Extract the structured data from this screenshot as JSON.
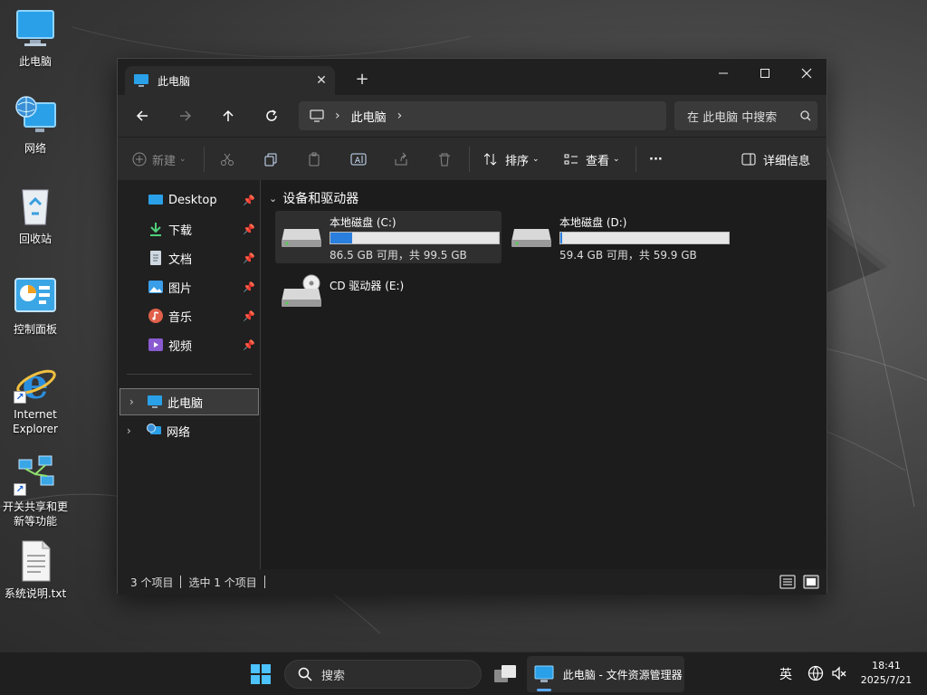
{
  "desktop": {
    "icons": [
      {
        "label": "此电脑",
        "icon": "computer-icon"
      },
      {
        "label": "网络",
        "icon": "network-globe-icon"
      },
      {
        "label": "回收站",
        "icon": "recycle-bin-icon"
      },
      {
        "label": "控制面板",
        "icon": "control-panel-icon"
      },
      {
        "label": "Internet\nExplorer",
        "icon": "internet-explorer-icon"
      },
      {
        "label": "开关共享和更\n新等功能",
        "icon": "share-network-icon"
      },
      {
        "label": "系统说明.txt",
        "icon": "text-file-icon"
      }
    ]
  },
  "window": {
    "tab_title": "此电脑",
    "tab_close": "✕",
    "new_tab": "+",
    "address": {
      "crumbs": [
        "此电脑"
      ]
    },
    "search_placeholder": "在 此电脑 中搜索",
    "toolbar": {
      "new_label": "新建",
      "sort_label": "排序",
      "view_label": "查看",
      "more_label": "···",
      "details_label": "详细信息"
    },
    "sidebar": {
      "quick_access": [
        {
          "label": "Desktop",
          "icon": "desktop-folder-icon"
        },
        {
          "label": "下载",
          "icon": "download-icon"
        },
        {
          "label": "文档",
          "icon": "document-icon"
        },
        {
          "label": "图片",
          "icon": "pictures-icon"
        },
        {
          "label": "音乐",
          "icon": "music-icon"
        },
        {
          "label": "视频",
          "icon": "video-icon"
        }
      ],
      "tree": [
        {
          "label": "此电脑",
          "icon": "computer-icon",
          "selected": true
        },
        {
          "label": "网络",
          "icon": "network-icon",
          "selected": false
        }
      ]
    },
    "content": {
      "group_title": "设备和驱动器",
      "drives": [
        {
          "name": "本地磁盘 (C:)",
          "free_text": "86.5 GB 可用，共 99.5 GB",
          "used_fraction": 0.13,
          "selected": true
        },
        {
          "name": "本地磁盘 (D:)",
          "free_text": "59.4 GB 可用，共 59.9 GB",
          "used_fraction": 0.01,
          "selected": false
        },
        {
          "name": "CD 驱动器 (E:)",
          "free_text": "",
          "used_fraction": null,
          "selected": false
        }
      ]
    },
    "status": {
      "item_count": "3 个项目",
      "selection": "选中 1 个项目"
    }
  },
  "taskbar": {
    "search_placeholder": "搜索",
    "app_label": "此电脑 - 文件资源管理器",
    "ime": "英",
    "time": "18:41",
    "date": "2025/7/21"
  },
  "colors": {
    "accent": "#2a7fde",
    "window_bg": "#202020",
    "toolbar_bg": "#2c2c2c"
  }
}
